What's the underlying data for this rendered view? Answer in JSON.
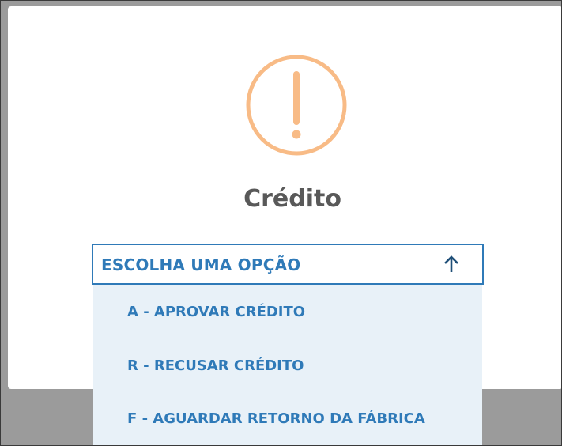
{
  "modal": {
    "title": "Crédito",
    "icon": "exclamation-circle-icon",
    "icon_color": "#f8bb86"
  },
  "select": {
    "label": "ESCOLHA UMA OPÇÃO",
    "arrow_icon": "arrow-up-icon",
    "accent_color": "#2f7ab8",
    "options": [
      {
        "label": "A - APROVAR CRÉDITO"
      },
      {
        "label": "R - RECUSAR CRÉDITO"
      },
      {
        "label": "F - AGUARDAR RETORNO DA FÁBRICA"
      }
    ]
  }
}
